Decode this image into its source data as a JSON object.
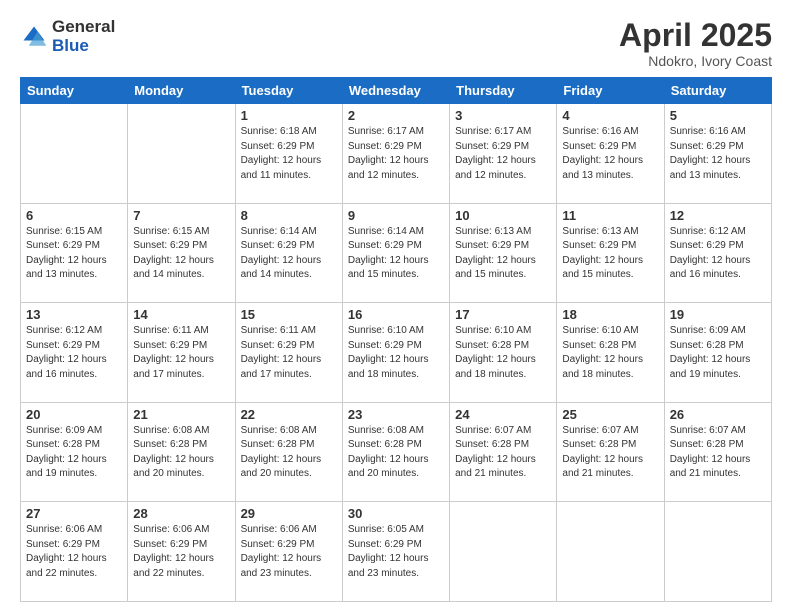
{
  "header": {
    "logo_general": "General",
    "logo_blue": "Blue",
    "month_title": "April 2025",
    "subtitle": "Ndokro, Ivory Coast"
  },
  "weekdays": [
    "Sunday",
    "Monday",
    "Tuesday",
    "Wednesday",
    "Thursday",
    "Friday",
    "Saturday"
  ],
  "weeks": [
    [
      {
        "day": "",
        "info": ""
      },
      {
        "day": "",
        "info": ""
      },
      {
        "day": "1",
        "info": "Sunrise: 6:18 AM\nSunset: 6:29 PM\nDaylight: 12 hours and 11 minutes."
      },
      {
        "day": "2",
        "info": "Sunrise: 6:17 AM\nSunset: 6:29 PM\nDaylight: 12 hours and 12 minutes."
      },
      {
        "day": "3",
        "info": "Sunrise: 6:17 AM\nSunset: 6:29 PM\nDaylight: 12 hours and 12 minutes."
      },
      {
        "day": "4",
        "info": "Sunrise: 6:16 AM\nSunset: 6:29 PM\nDaylight: 12 hours and 13 minutes."
      },
      {
        "day": "5",
        "info": "Sunrise: 6:16 AM\nSunset: 6:29 PM\nDaylight: 12 hours and 13 minutes."
      }
    ],
    [
      {
        "day": "6",
        "info": "Sunrise: 6:15 AM\nSunset: 6:29 PM\nDaylight: 12 hours and 13 minutes."
      },
      {
        "day": "7",
        "info": "Sunrise: 6:15 AM\nSunset: 6:29 PM\nDaylight: 12 hours and 14 minutes."
      },
      {
        "day": "8",
        "info": "Sunrise: 6:14 AM\nSunset: 6:29 PM\nDaylight: 12 hours and 14 minutes."
      },
      {
        "day": "9",
        "info": "Sunrise: 6:14 AM\nSunset: 6:29 PM\nDaylight: 12 hours and 15 minutes."
      },
      {
        "day": "10",
        "info": "Sunrise: 6:13 AM\nSunset: 6:29 PM\nDaylight: 12 hours and 15 minutes."
      },
      {
        "day": "11",
        "info": "Sunrise: 6:13 AM\nSunset: 6:29 PM\nDaylight: 12 hours and 15 minutes."
      },
      {
        "day": "12",
        "info": "Sunrise: 6:12 AM\nSunset: 6:29 PM\nDaylight: 12 hours and 16 minutes."
      }
    ],
    [
      {
        "day": "13",
        "info": "Sunrise: 6:12 AM\nSunset: 6:29 PM\nDaylight: 12 hours and 16 minutes."
      },
      {
        "day": "14",
        "info": "Sunrise: 6:11 AM\nSunset: 6:29 PM\nDaylight: 12 hours and 17 minutes."
      },
      {
        "day": "15",
        "info": "Sunrise: 6:11 AM\nSunset: 6:29 PM\nDaylight: 12 hours and 17 minutes."
      },
      {
        "day": "16",
        "info": "Sunrise: 6:10 AM\nSunset: 6:29 PM\nDaylight: 12 hours and 18 minutes."
      },
      {
        "day": "17",
        "info": "Sunrise: 6:10 AM\nSunset: 6:28 PM\nDaylight: 12 hours and 18 minutes."
      },
      {
        "day": "18",
        "info": "Sunrise: 6:10 AM\nSunset: 6:28 PM\nDaylight: 12 hours and 18 minutes."
      },
      {
        "day": "19",
        "info": "Sunrise: 6:09 AM\nSunset: 6:28 PM\nDaylight: 12 hours and 19 minutes."
      }
    ],
    [
      {
        "day": "20",
        "info": "Sunrise: 6:09 AM\nSunset: 6:28 PM\nDaylight: 12 hours and 19 minutes."
      },
      {
        "day": "21",
        "info": "Sunrise: 6:08 AM\nSunset: 6:28 PM\nDaylight: 12 hours and 20 minutes."
      },
      {
        "day": "22",
        "info": "Sunrise: 6:08 AM\nSunset: 6:28 PM\nDaylight: 12 hours and 20 minutes."
      },
      {
        "day": "23",
        "info": "Sunrise: 6:08 AM\nSunset: 6:28 PM\nDaylight: 12 hours and 20 minutes."
      },
      {
        "day": "24",
        "info": "Sunrise: 6:07 AM\nSunset: 6:28 PM\nDaylight: 12 hours and 21 minutes."
      },
      {
        "day": "25",
        "info": "Sunrise: 6:07 AM\nSunset: 6:28 PM\nDaylight: 12 hours and 21 minutes."
      },
      {
        "day": "26",
        "info": "Sunrise: 6:07 AM\nSunset: 6:28 PM\nDaylight: 12 hours and 21 minutes."
      }
    ],
    [
      {
        "day": "27",
        "info": "Sunrise: 6:06 AM\nSunset: 6:29 PM\nDaylight: 12 hours and 22 minutes."
      },
      {
        "day": "28",
        "info": "Sunrise: 6:06 AM\nSunset: 6:29 PM\nDaylight: 12 hours and 22 minutes."
      },
      {
        "day": "29",
        "info": "Sunrise: 6:06 AM\nSunset: 6:29 PM\nDaylight: 12 hours and 23 minutes."
      },
      {
        "day": "30",
        "info": "Sunrise: 6:05 AM\nSunset: 6:29 PM\nDaylight: 12 hours and 23 minutes."
      },
      {
        "day": "",
        "info": ""
      },
      {
        "day": "",
        "info": ""
      },
      {
        "day": "",
        "info": ""
      }
    ]
  ]
}
